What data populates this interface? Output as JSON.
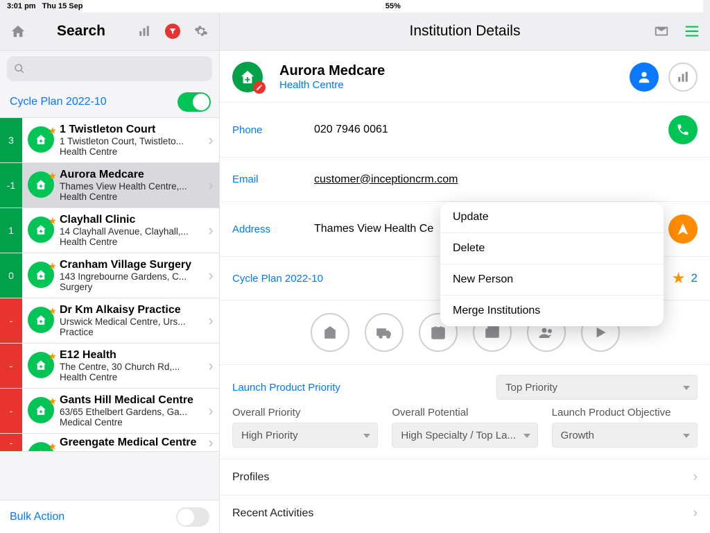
{
  "status": {
    "time": "3:01 pm",
    "date": "Thu 15 Sep",
    "battery": "55%"
  },
  "left": {
    "title": "Search",
    "search_placeholder": "",
    "cycleplan": "Cycle Plan 2022-10",
    "bulk": "Bulk Action",
    "items": [
      {
        "count": "3",
        "cc": "green",
        "name": "1 Twistleton Court",
        "sub": "1 Twistleton Court,  Twistleto...",
        "type": "Health Centre"
      },
      {
        "count": "-1",
        "cc": "green",
        "name": "Aurora Medcare",
        "sub": "Thames View Health Centre,...",
        "type": "Health Centre",
        "selected": true
      },
      {
        "count": "1",
        "cc": "green",
        "name": "Clayhall Clinic",
        "sub": "14 Clayhall Avenue,  Clayhall,...",
        "type": "Health Centre"
      },
      {
        "count": "0",
        "cc": "green",
        "name": "Cranham Village Surgery",
        "sub": "143 Ingrebourne Gardens,  C...",
        "type": "Surgery"
      },
      {
        "count": "-",
        "cc": "red",
        "name": "Dr Km Alkaisy Practice",
        "sub": "Urswick Medical Centre,  Urs...",
        "type": "Practice"
      },
      {
        "count": "-",
        "cc": "red",
        "name": "E12 Health",
        "sub": "The Centre,  30 Church Rd,...",
        "type": "Health Centre"
      },
      {
        "count": "-",
        "cc": "red",
        "name": "Gants Hill Medical Centre",
        "sub": "63/65 Ethelbert Gardens,  Ga...",
        "type": "Medical Centre"
      },
      {
        "count": "-",
        "cc": "red",
        "name": "Greengate Medical Centre",
        "sub": "",
        "type": ""
      }
    ]
  },
  "right": {
    "title": "Institution Details",
    "hero": {
      "name": "Aurora Medcare",
      "type": "Health Centre"
    },
    "phone_label": "Phone",
    "phone_value": "020 7946 0061",
    "email_label": "Email",
    "email_value": "customer@inceptioncrm.com",
    "addr_label": "Address",
    "addr_value": "Thames View Health Ce",
    "cp_label": "Cycle Plan 2022-10",
    "cp_count": "2",
    "launch_label": "Launch Product Priority",
    "launch_value": "Top Priority",
    "drops": [
      {
        "label": "Overall Priority",
        "value": "High Priority"
      },
      {
        "label": "Overall Potential",
        "value": "High Specialty / Top La..."
      },
      {
        "label": "Launch Product Objective",
        "value": "Growth"
      }
    ],
    "section_profiles": "Profiles",
    "section_recent": "Recent Activities"
  },
  "popover": {
    "items": [
      "Update",
      "Delete",
      "New Person",
      "Merge Institutions"
    ]
  }
}
